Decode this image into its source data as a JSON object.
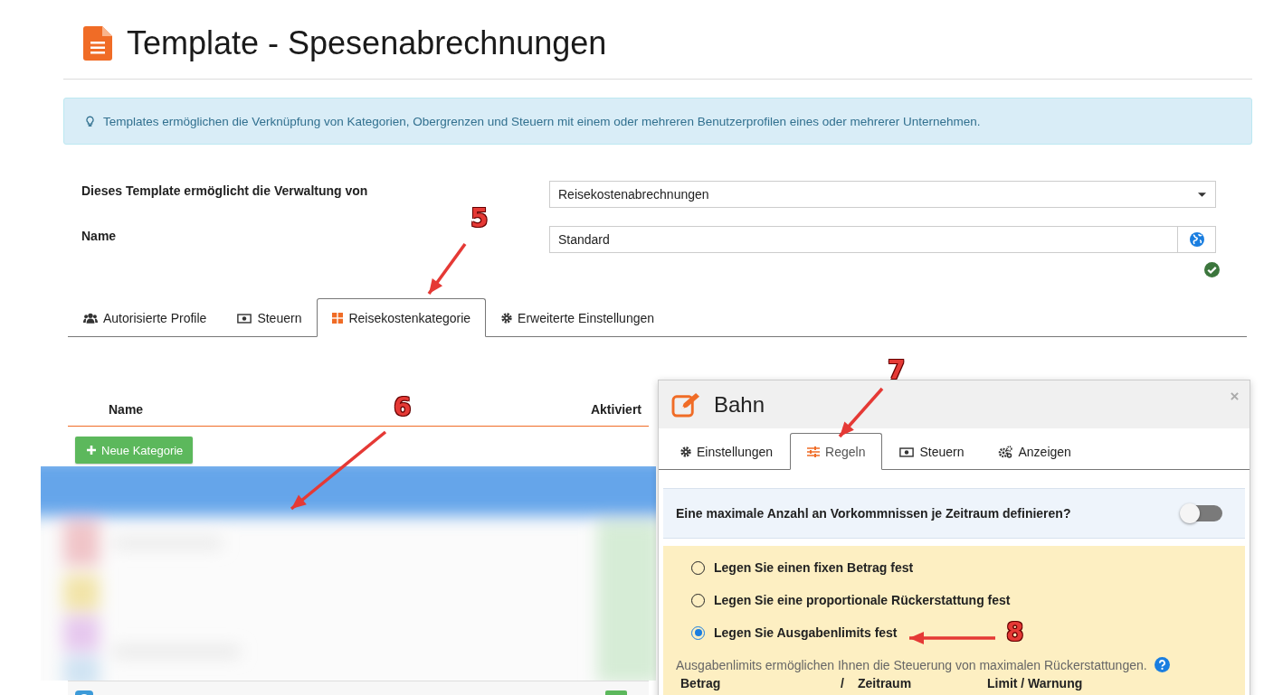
{
  "page": {
    "title": "Template - Spesenabrechnungen"
  },
  "info_alert": "Templates ermöglichen die Verknüpfung von Kategorien, Obergrenzen und Steuern mit einem oder mehreren Benutzerprofilen eines oder mehrerer Unternehmen.",
  "form": [
    {
      "label": "Dieses Template ermöglicht die Verwaltung von",
      "kind": "select",
      "value": "Reisekostenabrechnungen"
    },
    {
      "label": "Name",
      "kind": "text",
      "value": "Standard",
      "valid": true
    }
  ],
  "tabs": [
    {
      "label": "Autorisierte Profile",
      "selected": false
    },
    {
      "label": "Steuern",
      "selected": false
    },
    {
      "label": "Reisekostenkategorie",
      "selected": true
    },
    {
      "label": "Erweiterte Einstellungen",
      "selected": false
    }
  ],
  "category_table": {
    "columns": [
      "Name",
      "Aktiviert"
    ],
    "new_button": "Neue Kategorie",
    "blurred": {
      "kind": "picture"
    }
  },
  "dialog": {
    "title": "Bahn",
    "tabs": [
      {
        "label": "Einstellungen",
        "selected": false
      },
      {
        "label": "Regeln",
        "selected": true
      },
      {
        "label": "Steuern",
        "selected": false
      },
      {
        "label": "Anzeigen",
        "selected": false
      }
    ],
    "occurrence_limit": {
      "label": "Eine maximale Anzahl an Vorkommnissen je Zeitraum definieren?",
      "on": false
    },
    "rule_options": [
      {
        "label": "Legen Sie einen fixen Betrag fest",
        "selected": false
      },
      {
        "label": "Legen Sie eine proportionale Rückerstattung fest",
        "selected": false
      },
      {
        "label": "Legen Sie Ausgabenlimits fest",
        "selected": true
      }
    ],
    "hint": "Ausgabenlimits ermöglichen Ihnen die Steuerung von maximalen Rückerstattungen.",
    "limit_columns": [
      "Betrag",
      "/",
      "Zeitraum",
      "Limit / Warnung"
    ]
  },
  "annotations": [
    "5",
    "6",
    "7",
    "8"
  ]
}
